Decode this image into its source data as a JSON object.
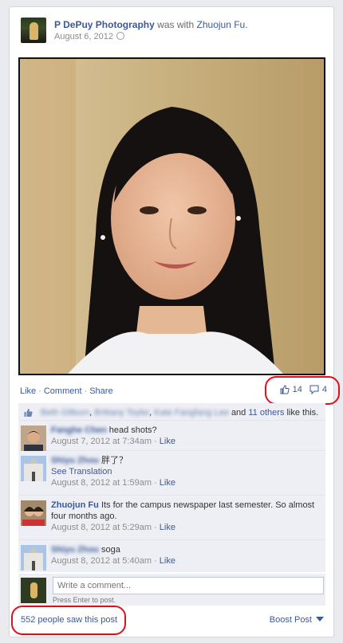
{
  "post": {
    "author": "P DePuy Photography",
    "with_text": "was with",
    "tagged": "Zhuojun Fu.",
    "date": "August 6, 2012"
  },
  "actions": {
    "like": "Like",
    "comment": "Comment",
    "share": "Share",
    "separator": "·"
  },
  "counts": {
    "likes": "14",
    "comments": "4"
  },
  "likes_row": {
    "names": [
      "Beth Gilburn",
      "Brittany Toyler",
      "Kate Fangfang Lee"
    ],
    "and_text": "and",
    "others": "11 others",
    "suffix": "like this."
  },
  "comments": [
    {
      "name": "Fanghe Chen",
      "text": "head shots?",
      "date": "August 7, 2012 at 7:34am",
      "like": "Like",
      "avatar": "avatar-man"
    },
    {
      "name": "Shiyu Zhou",
      "text": "胖了？",
      "translate": "See Translation",
      "date": "August 8, 2012 at 1:59am",
      "like": "Like",
      "avatar": "avatar-building"
    },
    {
      "name": "Zhuojun Fu",
      "text": "Its for the campus newspaper last semester. So almost four months ago.",
      "date": "August 8, 2012 at 5:29am",
      "like": "Like",
      "avatar": "avatar-two-women"
    },
    {
      "name": "Shiyu Zhou",
      "text": "soga",
      "date": "August 8, 2012 at 5:40am",
      "like": "Like",
      "avatar": "avatar-building"
    }
  ],
  "write": {
    "placeholder": "Write a comment...",
    "hint": "Press Enter to post."
  },
  "footer": {
    "seen": "552 people saw this post",
    "boost": "Boost Post"
  },
  "colors": {
    "link": "#3b5998",
    "highlight": "#e0101a"
  }
}
